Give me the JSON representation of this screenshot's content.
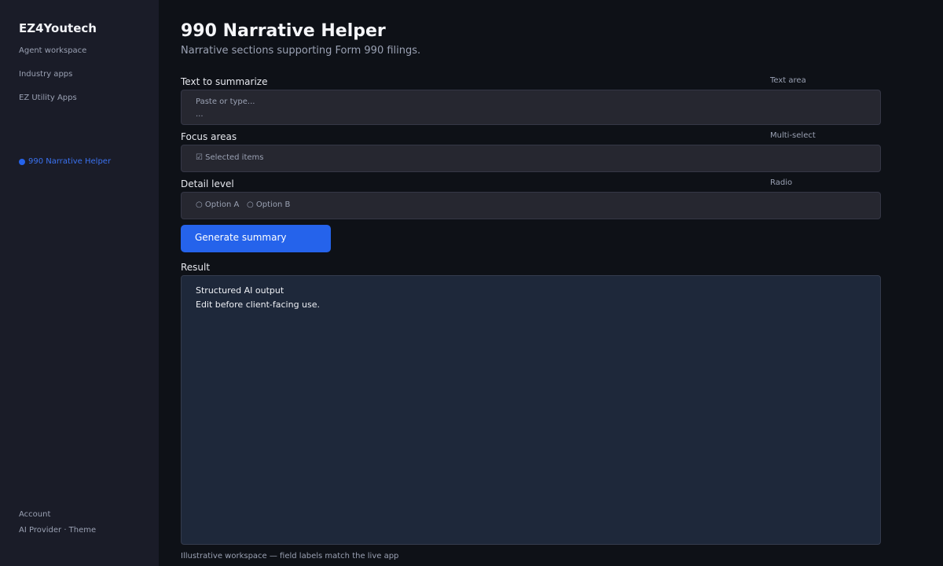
{
  "sidebar": {
    "brand": "EZ4Youtech",
    "links": [
      "Agent workspace",
      "Industry apps",
      "EZ Utility Apps"
    ],
    "active_item": "990 Narrative Helper",
    "bottom": {
      "account": "Account",
      "provider_theme": "AI Provider · Theme"
    }
  },
  "page": {
    "title": "990 Narrative Helper",
    "subtitle": "Narrative sections supporting Form 990 filings."
  },
  "fields": {
    "text": {
      "label": "Text to summarize",
      "type": "Text area",
      "placeholder_line1": "Paste or type...",
      "placeholder_line2": "..."
    },
    "focus": {
      "label": "Focus areas",
      "type": "Multi-select",
      "value": "☑ Selected items"
    },
    "detail": {
      "label": "Detail level",
      "type": "Radio",
      "option_a": "○ Option A",
      "option_b": "○ Option B"
    }
  },
  "button": {
    "label": "Generate summary"
  },
  "result": {
    "label": "Result",
    "line1": "Structured AI output",
    "line2": "Edit before client-facing use."
  },
  "footer": "Illustrative workspace — field labels match the live app",
  "colors": {
    "accent": "#2563eb",
    "sidebar_bg": "#1a1c28",
    "main_bg": "#0e1117",
    "field_bg": "#262730",
    "result_bg": "#1e283a"
  }
}
